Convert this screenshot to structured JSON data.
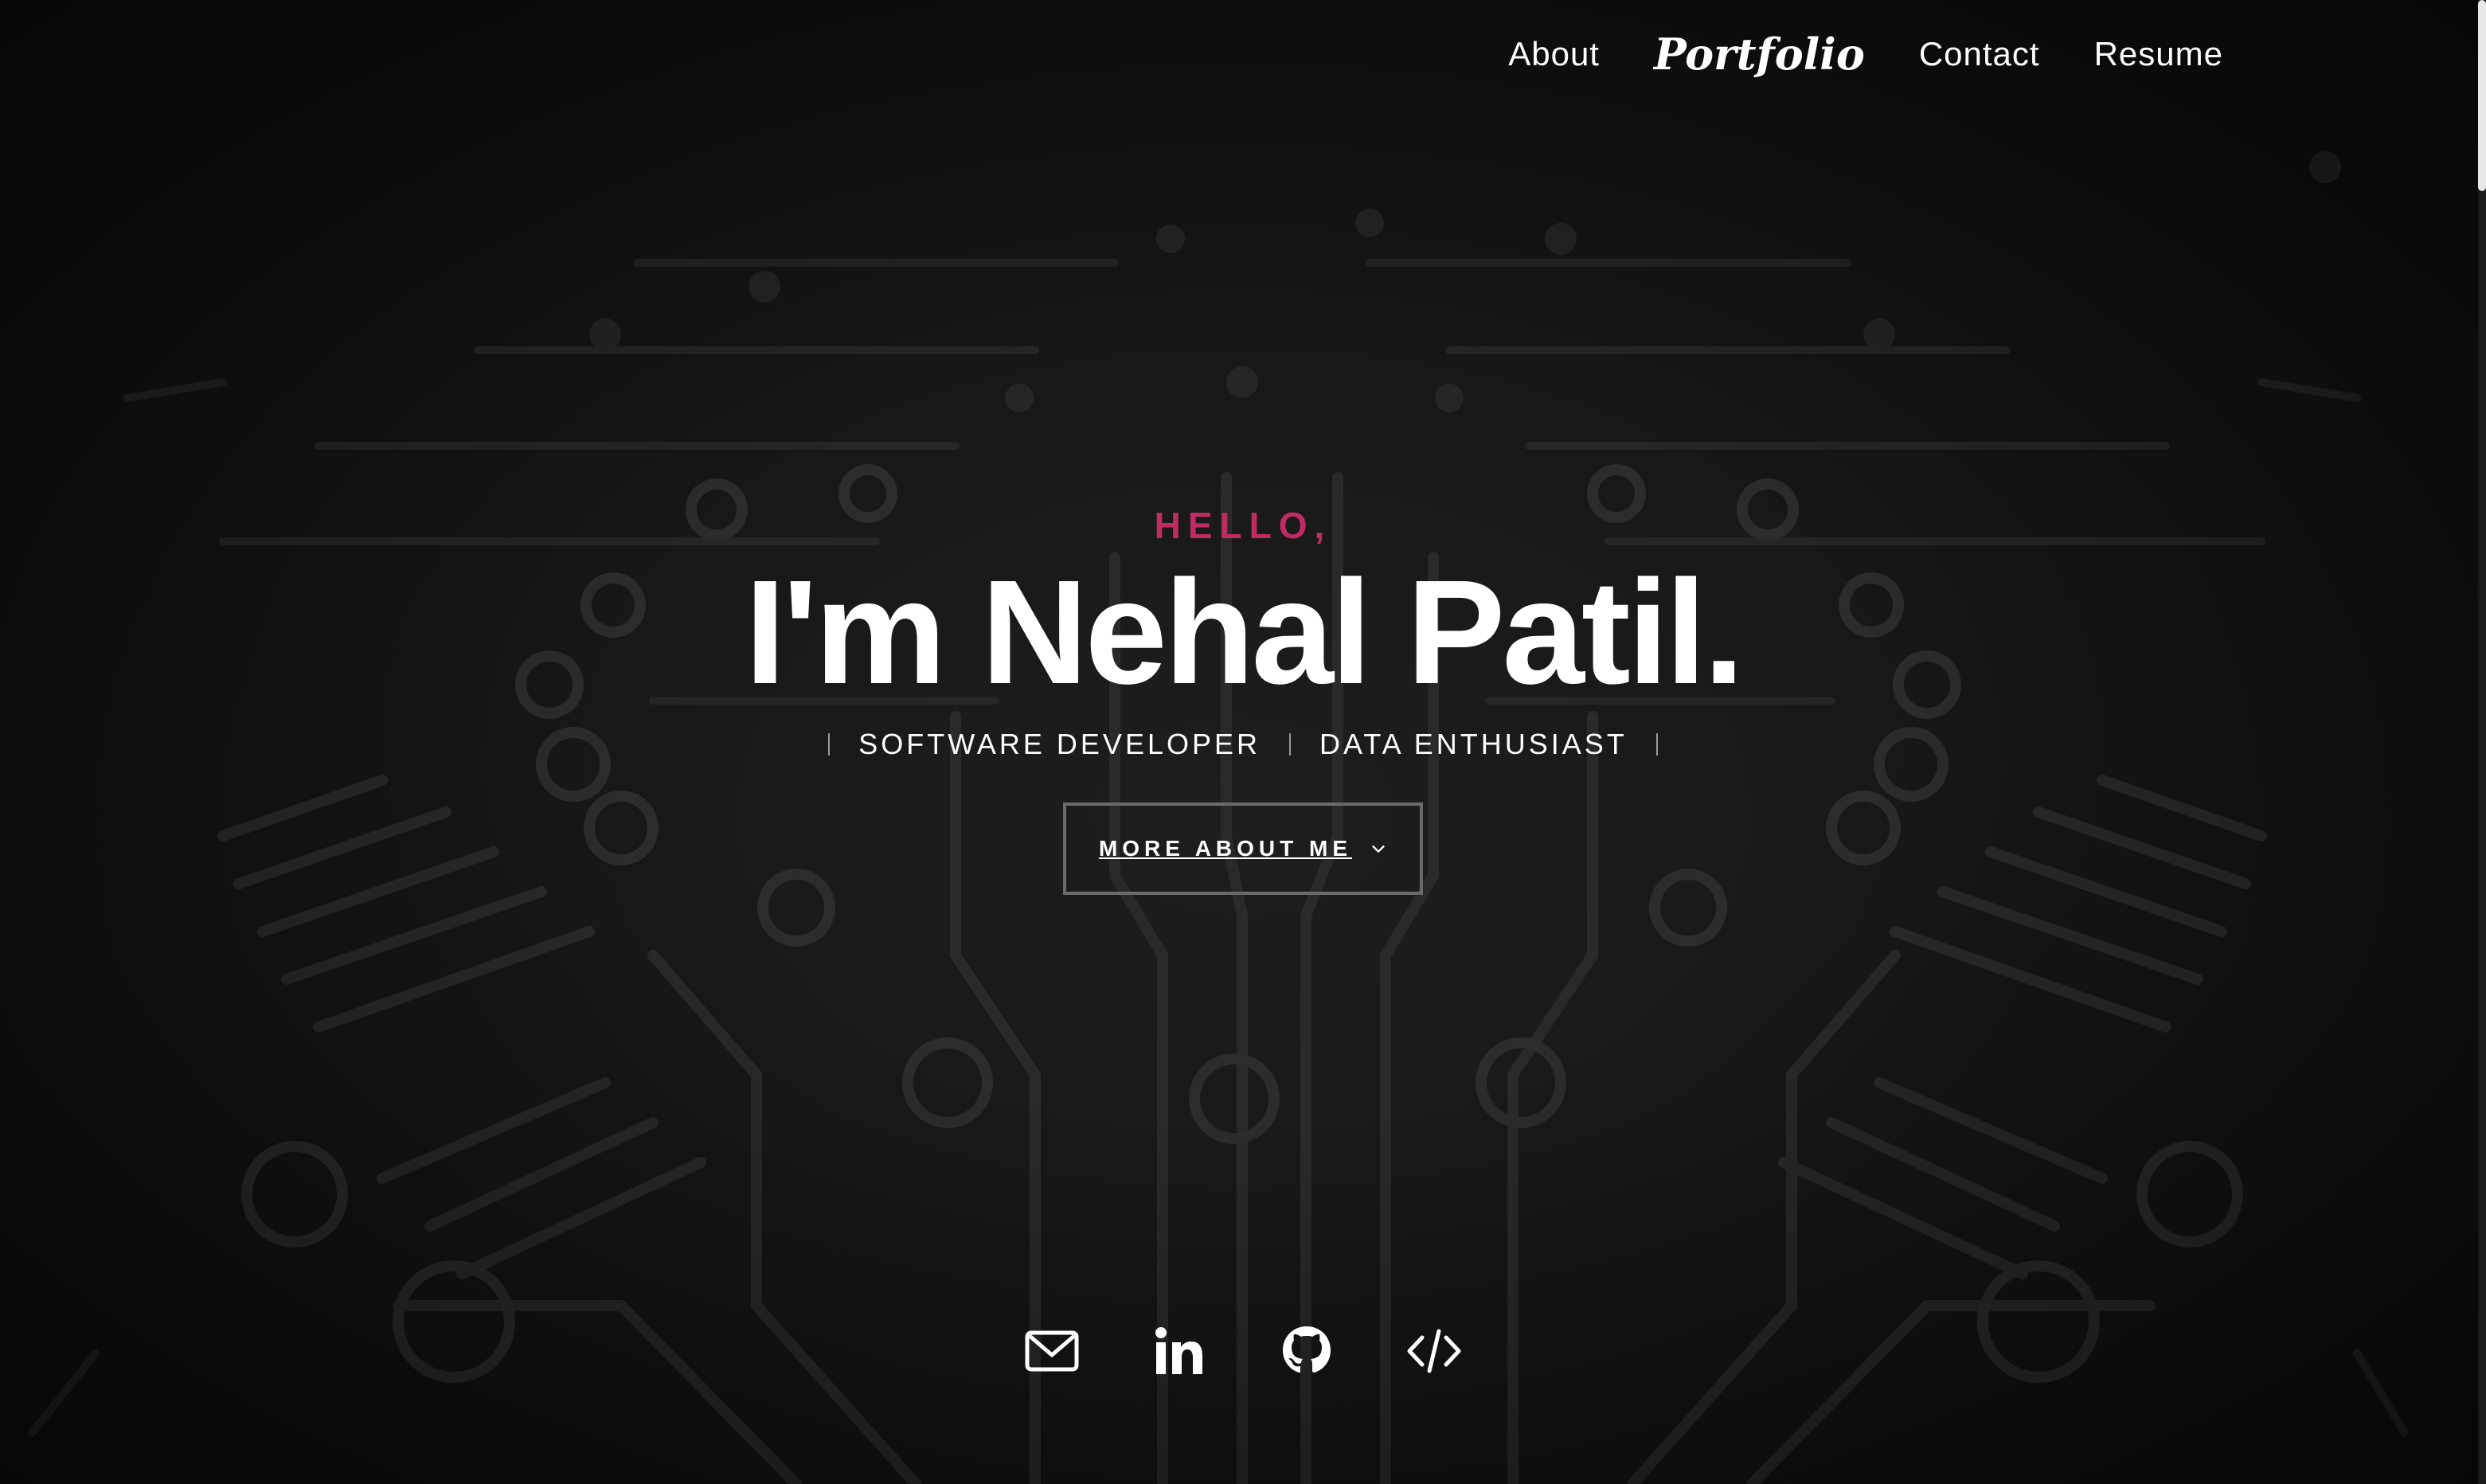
{
  "nav": {
    "items": [
      {
        "label": "About"
      },
      {
        "label": "Portfolio"
      },
      {
        "label": "Contact"
      },
      {
        "label": "Resume"
      }
    ]
  },
  "hero": {
    "greeting": "HELLO,",
    "name": "I'm Nehal Patil.",
    "roles": [
      "SOFTWARE DEVELOPER",
      "DATA ENTHUSIAST"
    ],
    "cta_label": "MORE ABOUT ME"
  },
  "social": {
    "icons": [
      "mail-icon",
      "linkedin-icon",
      "github-icon",
      "code-icon"
    ]
  },
  "colors": {
    "accent": "#c02b63",
    "background": "#121212",
    "text": "#ffffff"
  }
}
